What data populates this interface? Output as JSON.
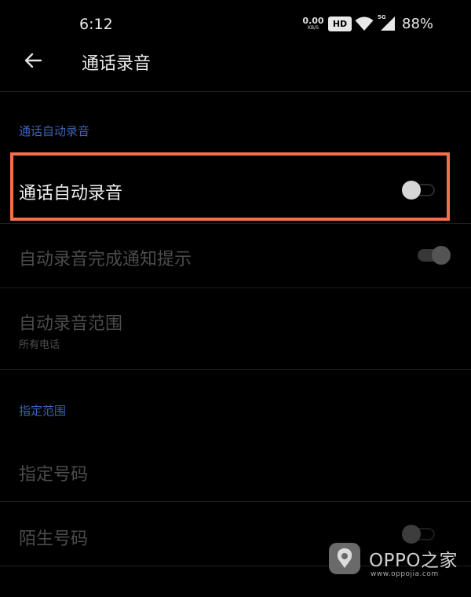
{
  "status_bar": {
    "time": "6:12",
    "net_speed_value": "0.00",
    "net_speed_unit": "KB/S",
    "hd_badge": "HD",
    "network_type": "5G",
    "battery": "88%"
  },
  "header": {
    "back_icon": "arrow-left-icon",
    "title": "通话录音"
  },
  "sections": {
    "auto_record": {
      "title": "通话自动录音",
      "items": {
        "auto_record_toggle": {
          "label": "通话自动录音",
          "on": false,
          "enabled": true
        },
        "notify_toggle": {
          "label": "自动录音完成通知提示",
          "on": true,
          "enabled": false
        },
        "scope": {
          "label": "自动录音范围",
          "sublabel": "所有电话",
          "enabled": false
        }
      }
    },
    "specified_scope": {
      "title": "指定范围",
      "items": {
        "specified_numbers": {
          "label": "指定号码",
          "enabled": false
        },
        "unknown_numbers": {
          "label": "陌生号码",
          "on": false,
          "enabled": false
        }
      }
    }
  },
  "watermark": {
    "brand": "OPPO之家",
    "url": "www.oppojia.com"
  },
  "colors": {
    "background": "#000000",
    "section_title": "#3d62b4",
    "highlight_border": "#f4704c"
  }
}
